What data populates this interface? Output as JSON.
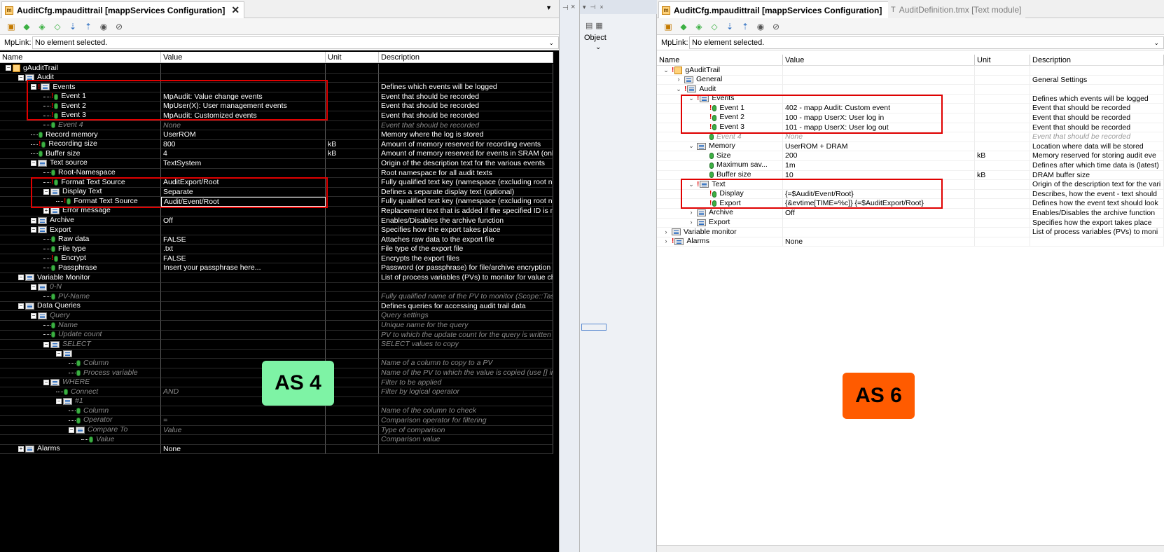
{
  "left": {
    "tab_title": "AuditCfg.mpaudittrail [mappServices Configuration]",
    "mplink_label": "MpLink:",
    "mplink_value": "No element selected.",
    "columns": [
      "Name",
      "Value",
      "Unit",
      "Description"
    ],
    "badge": "AS 4",
    "rows": [
      {
        "name": "gAuditTrail",
        "value": "",
        "unit": "",
        "desc": ""
      },
      {
        "name": "Audit",
        "value": "",
        "unit": "",
        "desc": ""
      },
      {
        "name": "Events",
        "value": "",
        "unit": "",
        "desc": "Defines which events will be logged"
      },
      {
        "name": "Event 1",
        "value": "MpAudit: Value change events",
        "unit": "",
        "desc": "Event that should be recorded"
      },
      {
        "name": "Event 2",
        "value": "MpUser(X): User management events",
        "unit": "",
        "desc": "Event that should be recorded"
      },
      {
        "name": "Event 3",
        "value": "MpAudit: Customized events",
        "unit": "",
        "desc": "Event that should be recorded"
      },
      {
        "name": "Event 4",
        "value": "None",
        "unit": "",
        "desc": "Event that should be recorded"
      },
      {
        "name": "Record memory",
        "value": "UserROM",
        "unit": "",
        "desc": "Memory where the log is stored"
      },
      {
        "name": "Recording size",
        "value": "800",
        "unit": "kB",
        "desc": "Amount of memory reserved for recording events"
      },
      {
        "name": "Buffer size",
        "value": "4",
        "unit": "kB",
        "desc": "Amount of memory reserved for events in SRAM (only us"
      },
      {
        "name": "Text source",
        "value": "TextSystem",
        "unit": "",
        "desc": "Origin of the description text for the various events"
      },
      {
        "name": "Root-Namespace",
        "value": "",
        "unit": "",
        "desc": "Root namespace for all audit texts"
      },
      {
        "name": "Format Text Source",
        "value": "AuditExport/Root",
        "unit": "",
        "desc": "Fully qualified text key (namespace (excluding root nam"
      },
      {
        "name": "Display Text",
        "value": "Separate",
        "unit": "",
        "desc": "Defines a separate display text (optional)"
      },
      {
        "name": "Format Text Source",
        "value": "Audit/Event/Root",
        "unit": "",
        "desc": "Fully qualified text key (namespace (excluding root nam"
      },
      {
        "name": "Error message",
        "value": "",
        "unit": "",
        "desc": "Replacement text that is added if the specified ID is not f"
      },
      {
        "name": "Archive",
        "value": "Off",
        "unit": "",
        "desc": "Enables/Disables the archive function"
      },
      {
        "name": "Export",
        "value": "",
        "unit": "",
        "desc": "Specifies how the export takes place"
      },
      {
        "name": "Raw data",
        "value": "FALSE",
        "unit": "",
        "desc": "Attaches raw data to the export file"
      },
      {
        "name": "File type",
        "value": ".txt",
        "unit": "",
        "desc": "File type of the export file"
      },
      {
        "name": "Encrypt",
        "value": "FALSE",
        "unit": "",
        "desc": "Encrypts the export files"
      },
      {
        "name": "Passphrase",
        "value": "Insert your passphrase here...",
        "unit": "",
        "desc": "Password (or passphrase) for file/archive encryption"
      },
      {
        "name": "Variable Monitor",
        "value": "",
        "unit": "",
        "desc": "List of process variables (PVs) to monitor for value chan"
      },
      {
        "name": "0-N",
        "value": "",
        "unit": "",
        "desc": ""
      },
      {
        "name": "PV-Name",
        "value": "",
        "unit": "",
        "desc": "Fully qualified name of the PV to monitor (Scope::Task:("
      },
      {
        "name": "Data Queries",
        "value": "",
        "unit": "",
        "desc": "Defines queries for accessing audit trail data"
      },
      {
        "name": "Query",
        "value": "",
        "unit": "",
        "desc": "Query settings"
      },
      {
        "name": "Name",
        "value": "",
        "unit": "",
        "desc": "Unique name for the query"
      },
      {
        "name": "Update count",
        "value": "",
        "unit": "",
        "desc": "PV to which the update count for the query is written (inc"
      },
      {
        "name": "SELECT",
        "value": "",
        "unit": "",
        "desc": "SELECT values to copy"
      },
      {
        "name": "",
        "value": "",
        "unit": "",
        "desc": ""
      },
      {
        "name": "Column",
        "value": "",
        "unit": "",
        "desc": "Name of a column to copy to a PV"
      },
      {
        "name": "Process variable",
        "value": "",
        "unit": "",
        "desc": "Name of the PV to which the value is copied (use [] inste"
      },
      {
        "name": "WHERE",
        "value": "",
        "unit": "",
        "desc": "Filter to be applied"
      },
      {
        "name": "Connect",
        "value": "AND",
        "unit": "",
        "desc": "Filter by logical operator"
      },
      {
        "name": "#1",
        "value": "",
        "unit": "",
        "desc": ""
      },
      {
        "name": "Column",
        "value": "",
        "unit": "",
        "desc": "Name of the column to check"
      },
      {
        "name": "Operator",
        "value": "=",
        "unit": "",
        "desc": "Comparison operator for filtering"
      },
      {
        "name": "Compare To",
        "value": "Value",
        "unit": "",
        "desc": "Type of comparison"
      },
      {
        "name": "Value",
        "value": "",
        "unit": "",
        "desc": "Comparison value"
      },
      {
        "name": "Alarms",
        "value": "None",
        "unit": "",
        "desc": ""
      }
    ]
  },
  "middle": {
    "object_label": "Object"
  },
  "right": {
    "tab_title": "AuditCfg.mpaudittrail [mappServices Configuration]",
    "tab2_title": "AuditDefinition.tmx [Text module]",
    "mplink_label": "MpLink:",
    "mplink_value": "No element selected.",
    "columns": [
      "Name",
      "Value",
      "Unit",
      "Description"
    ],
    "badge": "AS 6",
    "rows": [
      {
        "name": "gAuditTrail",
        "value": "",
        "unit": "",
        "desc": ""
      },
      {
        "name": "General",
        "value": "",
        "unit": "",
        "desc": "General Settings"
      },
      {
        "name": "Audit",
        "value": "",
        "unit": "",
        "desc": ""
      },
      {
        "name": "Events",
        "value": "",
        "unit": "",
        "desc": "Defines which events will be logged"
      },
      {
        "name": "Event 1",
        "value": "402 - mapp Audit: Custom event",
        "unit": "",
        "desc": "Event that should be recorded"
      },
      {
        "name": "Event 2",
        "value": "100 - mapp UserX: User log in",
        "unit": "",
        "desc": "Event that should be recorded"
      },
      {
        "name": "Event 3",
        "value": "101 - mapp UserX: User log out",
        "unit": "",
        "desc": "Event that should be recorded"
      },
      {
        "name": "Event 4",
        "value": "None",
        "unit": "",
        "desc": "Event that should be recorded"
      },
      {
        "name": "Memory",
        "value": "UserROM + DRAM",
        "unit": "",
        "desc": "Location where data will be stored"
      },
      {
        "name": "Size",
        "value": "200",
        "unit": "kB",
        "desc": "Memory reserved for storing audit eve"
      },
      {
        "name": "Maximum sav...",
        "value": "1m",
        "unit": "",
        "desc": "Defines after which time data is (latest)"
      },
      {
        "name": "Buffer size",
        "value": "10",
        "unit": "kB",
        "desc": "DRAM buffer size"
      },
      {
        "name": "Text",
        "value": "",
        "unit": "",
        "desc": "Origin of the description text for the vari"
      },
      {
        "name": "Display",
        "value": "{=$Audit/Event/Root}",
        "unit": "",
        "desc": "Describes, how the event - text should"
      },
      {
        "name": "Export",
        "value": "{&evtime[TIME=%c]} {=$AuditExport/Root}",
        "unit": "",
        "desc": "Defines how the event text should look"
      },
      {
        "name": "Archive",
        "value": "Off",
        "unit": "",
        "desc": "Enables/Disables the archive function"
      },
      {
        "name": "Export",
        "value": "",
        "unit": "",
        "desc": "Specifies how the export takes place"
      },
      {
        "name": "Variable monitor",
        "value": "",
        "unit": "",
        "desc": "List of process variables (PVs) to moni"
      },
      {
        "name": "Alarms",
        "value": "None",
        "unit": "",
        "desc": ""
      }
    ]
  }
}
